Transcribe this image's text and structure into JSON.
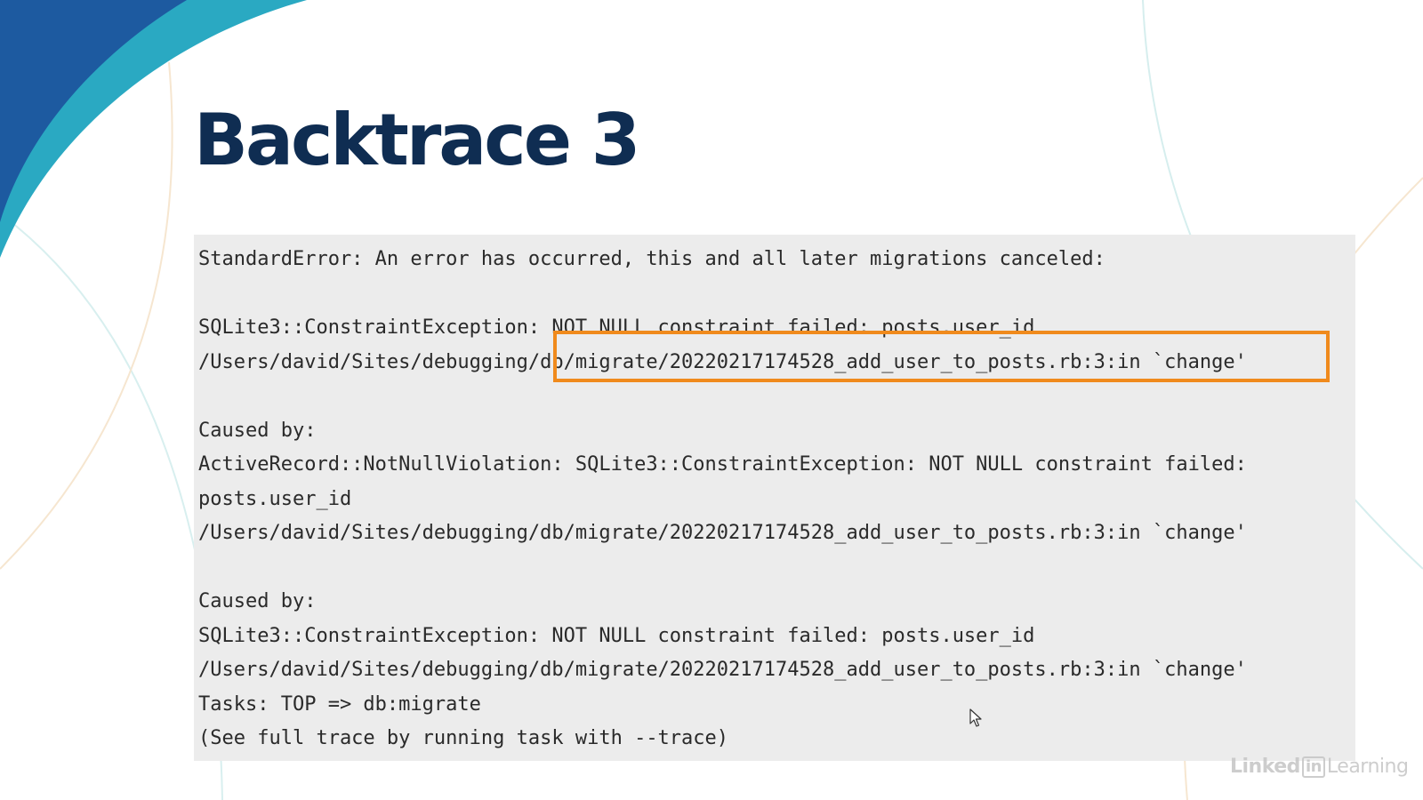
{
  "slide": {
    "title": "Backtrace 3",
    "colors": {
      "title": "#0f2d52",
      "swoosh_dark": "#1d5aa0",
      "swoosh_light": "#2aa9c2",
      "code_bg": "#ececec",
      "highlight_border": "#f08a1c"
    }
  },
  "code": {
    "lines": [
      "StandardError: An error has occurred, this and all later migrations canceled:",
      "",
      "SQLite3::ConstraintException: NOT NULL constraint failed: posts.user_id",
      "/Users/david/Sites/debugging/db/migrate/20220217174528_add_user_to_posts.rb:3:in `change'",
      "",
      "Caused by:",
      "ActiveRecord::NotNullViolation: SQLite3::ConstraintException: NOT NULL constraint failed:",
      "posts.user_id",
      "/Users/david/Sites/debugging/db/migrate/20220217174528_add_user_to_posts.rb:3:in `change'",
      "",
      "Caused by:",
      "SQLite3::ConstraintException: NOT NULL constraint failed: posts.user_id",
      "/Users/david/Sites/debugging/db/migrate/20220217174528_add_user_to_posts.rb:3:in `change'",
      "Tasks: TOP => db:migrate",
      "(See full trace by running task with --trace)"
    ],
    "highlighted_text": "db/migrate/20220217174528_add_user_to_posts.rb:3:in `change'"
  },
  "watermark": {
    "linked": "Linked",
    "in": "in",
    "learning": "Learning"
  },
  "icons": {
    "cursor": "mouse-pointer-icon",
    "logo": "linkedin-learning-logo"
  }
}
